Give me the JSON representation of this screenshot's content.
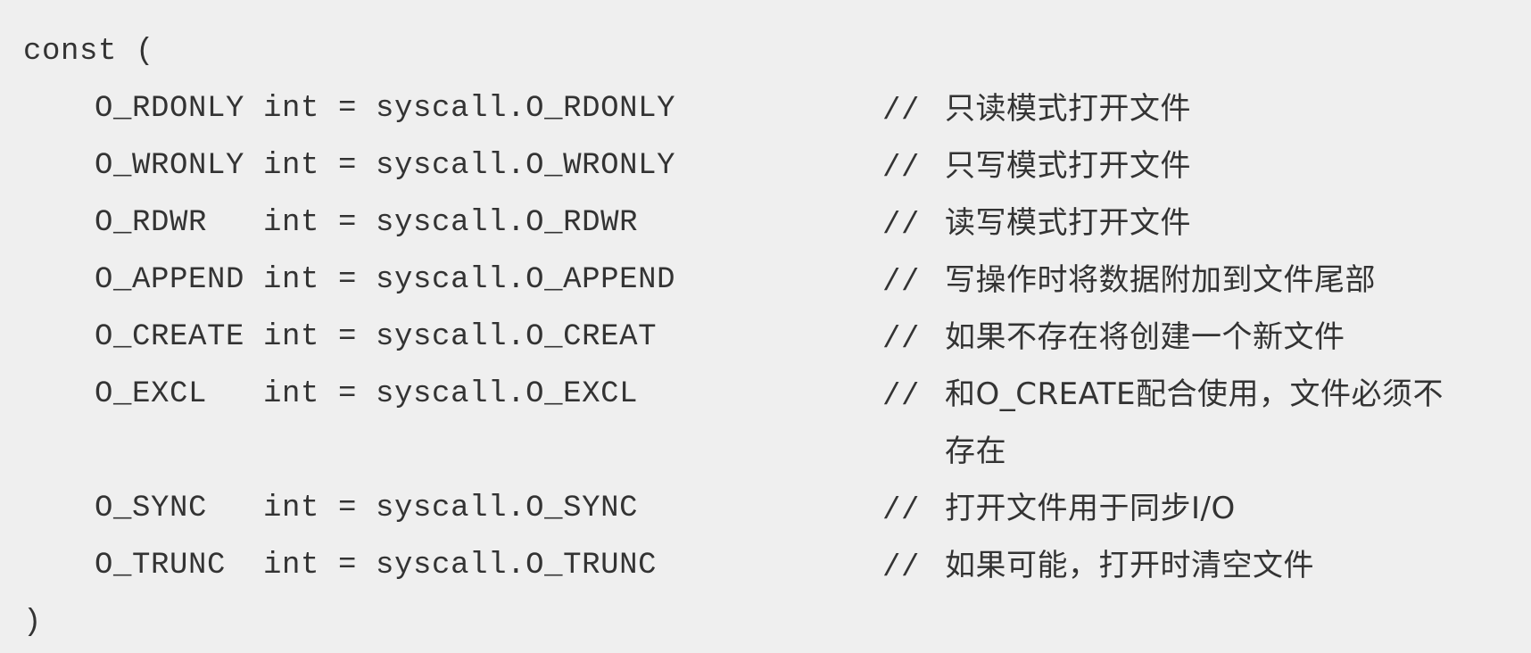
{
  "code": {
    "open": "const (",
    "close": ")",
    "comment_marker": "//",
    "lines": [
      {
        "decl": "O_RDONLY int = syscall.O_RDONLY",
        "comment": "只读模式打开文件"
      },
      {
        "decl": "O_WRONLY int = syscall.O_WRONLY",
        "comment": "只写模式打开文件"
      },
      {
        "decl": "O_RDWR   int = syscall.O_RDWR",
        "comment": "读写模式打开文件"
      },
      {
        "decl": "O_APPEND int = syscall.O_APPEND",
        "comment": "写操作时将数据附加到文件尾部"
      },
      {
        "decl": "O_CREATE int = syscall.O_CREAT",
        "comment": "如果不存在将创建一个新文件"
      },
      {
        "decl": "O_EXCL   int = syscall.O_EXCL",
        "comment": "和O_CREATE配合使用，文件必须不",
        "comment_cont": "存在"
      },
      {
        "decl": "O_SYNC   int = syscall.O_SYNC",
        "comment": "打开文件用于同步I/O"
      },
      {
        "decl": "O_TRUNC  int = syscall.O_TRUNC",
        "comment": "如果可能，打开时清空文件"
      }
    ]
  }
}
